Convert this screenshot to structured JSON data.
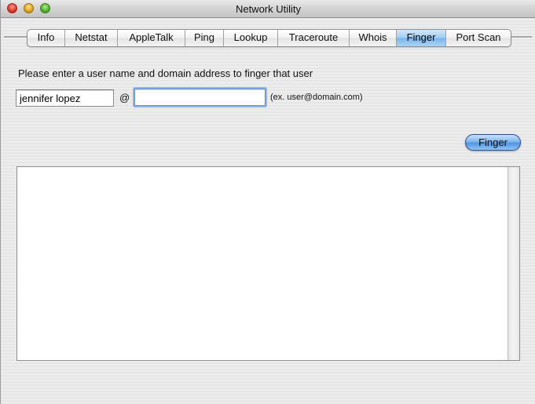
{
  "window": {
    "title": "Network Utility"
  },
  "tabs": [
    {
      "label": "Info",
      "selected": false
    },
    {
      "label": "Netstat",
      "selected": false
    },
    {
      "label": "AppleTalk",
      "selected": false
    },
    {
      "label": "Ping",
      "selected": false
    },
    {
      "label": "Lookup",
      "selected": false
    },
    {
      "label": "Traceroute",
      "selected": false
    },
    {
      "label": "Whois",
      "selected": false
    },
    {
      "label": "Finger",
      "selected": true
    },
    {
      "label": "Port Scan",
      "selected": false
    }
  ],
  "finger": {
    "prompt": "Please enter a user name and domain address to finger that user",
    "user_value": "jennifer lopez",
    "at_symbol": "@",
    "domain_value": "",
    "example_hint": "(ex. user@domain.com)",
    "button_label": "Finger",
    "output_text": ""
  },
  "colors": {
    "selected_tab": "#9fcbf1",
    "button_accent": "#4f96e3",
    "focus_ring": "#8cb5ea"
  }
}
